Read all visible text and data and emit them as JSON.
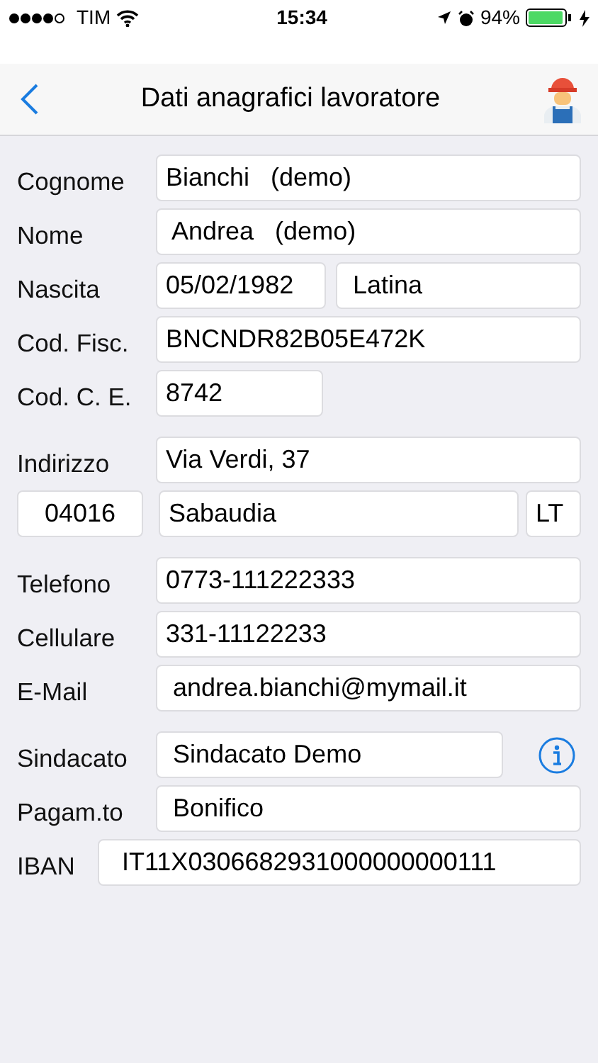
{
  "status_bar": {
    "carrier": "TIM",
    "time": "15:34",
    "battery": "94%"
  },
  "nav_bar": {
    "title": "Dati anagrafici lavoratore"
  },
  "groups": [
    {
      "rows": [
        {
          "kind": "text",
          "label": "Cognome",
          "values": [
            "Bianchi   (demo)"
          ]
        },
        {
          "kind": "text",
          "label": "Nome",
          "values": [
            " Andrea   (demo)"
          ]
        },
        {
          "kind": "pair",
          "label": "Nascita",
          "values": [
            "05/02/1982",
            " Latina"
          ]
        },
        {
          "kind": "text",
          "label": "Cod. Fisc.",
          "values": [
            "BNCNDR82B05E472K"
          ]
        },
        {
          "kind": "short",
          "label": "Cod. C. E.",
          "values": [
            "8742"
          ]
        }
      ]
    },
    {
      "rows": [
        {
          "kind": "text",
          "label": "Indirizzo",
          "values": [
            "Via Verdi, 37"
          ]
        },
        {
          "kind": "address",
          "values": [
            "04016",
            "Sabaudia",
            "LT"
          ]
        }
      ]
    },
    {
      "rows": [
        {
          "kind": "text",
          "label": "Telefono",
          "values": [
            "0773-111222333"
          ]
        },
        {
          "kind": "text",
          "label": "Cellulare",
          "values": [
            "331-11122233"
          ]
        },
        {
          "kind": "text",
          "label": "E-Mail",
          "values": [
            " andrea.bianchi@mymail.it"
          ]
        }
      ]
    },
    {
      "rows": [
        {
          "kind": "info",
          "label": "Sindacato",
          "values": [
            " Sindacato Demo"
          ]
        },
        {
          "kind": "text",
          "label": "Pagam.to",
          "values": [
            " Bonifico"
          ]
        },
        {
          "kind": "wide",
          "label": "IBAN",
          "values": [
            "  IT11X0306682931000000000111"
          ]
        }
      ]
    }
  ]
}
